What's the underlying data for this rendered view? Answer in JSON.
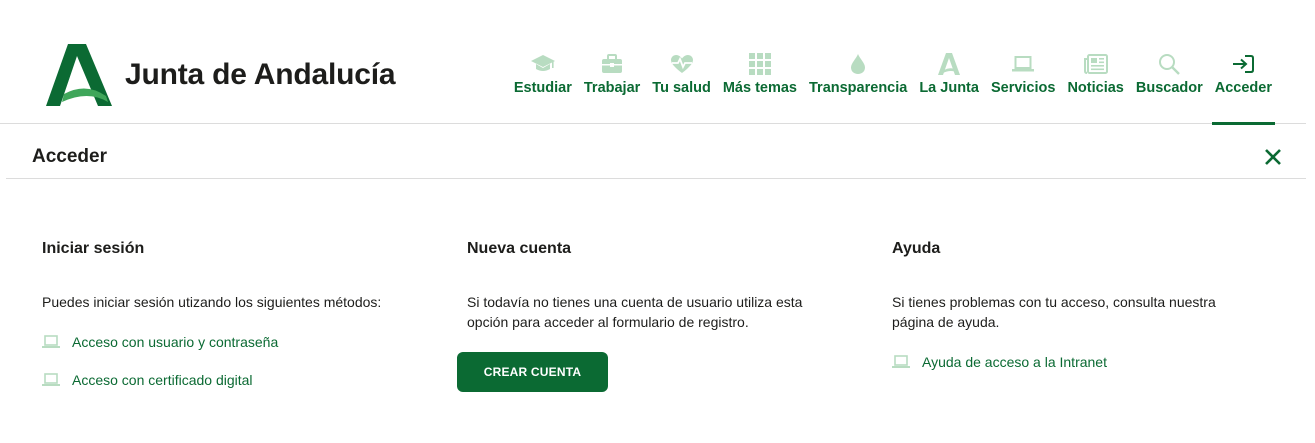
{
  "header": {
    "logo_text": "Junta de Andalucía",
    "nav": [
      {
        "label": "Estudiar",
        "icon": "graduation-cap-icon"
      },
      {
        "label": "Trabajar",
        "icon": "briefcase-icon"
      },
      {
        "label": "Tu salud",
        "icon": "heart-pulse-icon"
      },
      {
        "label": "Más temas",
        "icon": "grid-icon"
      },
      {
        "label": "Transparencia",
        "icon": "drop-icon"
      },
      {
        "label": "La Junta",
        "icon": "junta-logo-icon"
      },
      {
        "label": "Servicios",
        "icon": "laptop-icon"
      },
      {
        "label": "Noticias",
        "icon": "newspaper-icon"
      },
      {
        "label": "Buscador",
        "icon": "search-icon"
      },
      {
        "label": "Acceder",
        "icon": "sign-in-icon",
        "active": true
      }
    ]
  },
  "panel": {
    "title": "Acceder",
    "close_icon": "close-icon"
  },
  "login": {
    "title": "Iniciar sesión",
    "text": "Puedes iniciar sesión utizando los siguientes métodos:",
    "links": [
      "Acceso con usuario  y contraseña",
      "Acceso con certificado digital"
    ]
  },
  "register": {
    "title": "Nueva cuenta",
    "text": "Si todavía no tienes una cuenta de usuario utiliza esta opción para acceder al formulario de registro.",
    "button": "CREAR CUENTA"
  },
  "help": {
    "title": "Ayuda",
    "text": "Si tienes problemas con tu acceso, consulta nuestra página de ayuda.",
    "link": "Ayuda de acceso a la Intranet"
  },
  "colors": {
    "brand": "#0b6a33",
    "icon_light": "#b8dcc1",
    "text": "#1d1d1b"
  }
}
